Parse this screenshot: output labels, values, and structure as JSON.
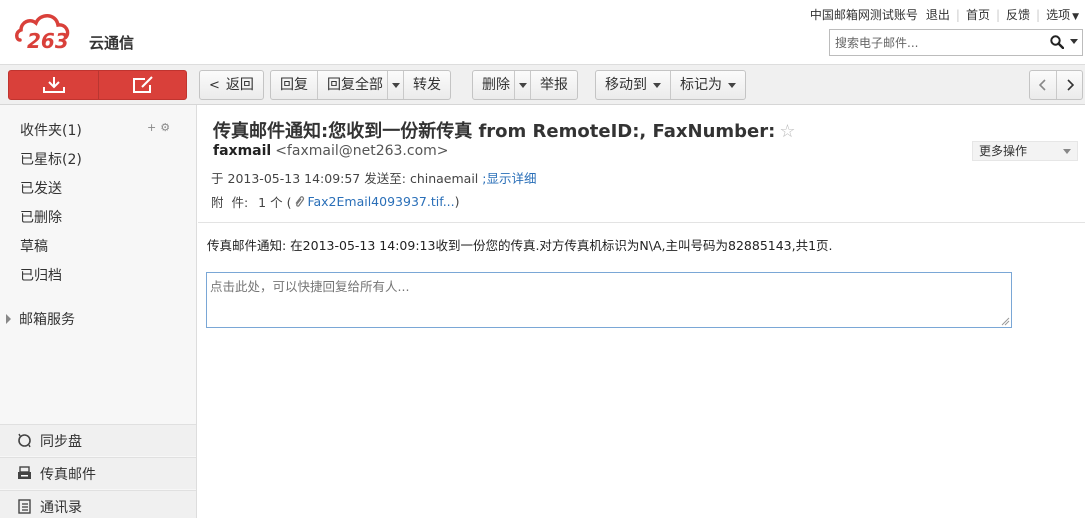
{
  "app": {
    "logo_text": "263云通信",
    "brand_color": "#d9403a"
  },
  "header": {
    "account_label": "中国邮箱网测试账号",
    "logout_label": "退出",
    "home_label": "首页",
    "feedback_label": "反馈",
    "options_label": "选项",
    "search_placeholder": "搜索电子邮件..."
  },
  "toolbar": {
    "receive_icon": "download-icon",
    "compose_icon": "compose-icon",
    "back_label": "返回",
    "reply_label": "回复",
    "reply_all_label": "回复全部",
    "forward_label": "转发",
    "delete_label": "删除",
    "report_label": "举报",
    "move_to_label": "移动到",
    "mark_as_label": "标记为"
  },
  "sidebar": {
    "folders": [
      {
        "label": "收件夹(1)"
      },
      {
        "label": "已星标(2)"
      },
      {
        "label": "已发送"
      },
      {
        "label": "已删除"
      },
      {
        "label": "草稿"
      },
      {
        "label": "已归档"
      }
    ],
    "folder_tools": {
      "add": "+",
      "settings": "⚙"
    },
    "mail_service_label": "邮箱服务",
    "bottom_items": [
      {
        "label": "同步盘",
        "icon": "sync-icon"
      },
      {
        "label": "传真邮件",
        "icon": "fax-icon"
      },
      {
        "label": "通讯录",
        "icon": "contacts-icon"
      }
    ]
  },
  "message": {
    "subject": "传真邮件通知:您收到一份新传真 from RemoteID:, FaxNumber:",
    "star_glyph": "☆",
    "sender_name": "faxmail",
    "sender_address": "<faxmail@net263.com>",
    "more_actions_label": "更多操作",
    "date_prefix": "于",
    "date": "2013-05-13 14:09:57",
    "sent_to_label": "发送至:",
    "recipient": "chinaemail",
    "show_details_label": ";显示详细",
    "attachment_label": "附  件:",
    "attachment_count": "1 个 (",
    "attachment_name": "Fax2Email4093937.tif...",
    "attachment_close": ")",
    "body": "传真邮件通知: 在2013-05-13 14:09:13收到一份您的传真.对方传真机标识为N\\A,主叫号码为82885143,共1页.",
    "quick_reply_placeholder": "点击此处，可以快捷回复给所有人..."
  }
}
